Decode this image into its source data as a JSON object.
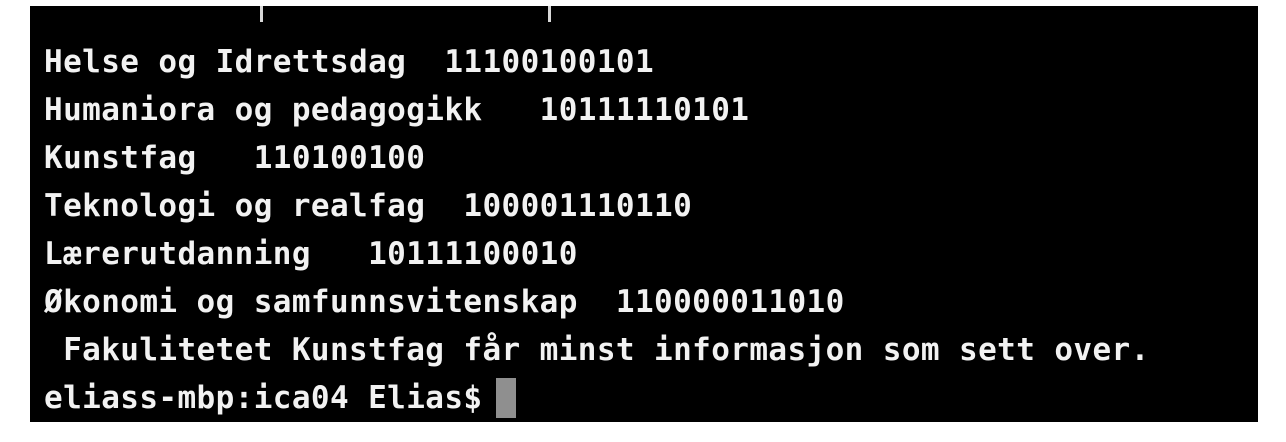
{
  "terminal": {
    "output_lines": [
      "Helse og Idrettsdag  11100100101",
      "Humaniora og pedagogikk   10111110101",
      "Kunstfag   110100100",
      "Teknologi og realfag  100001110110",
      "Lærerutdanning   10111100010",
      "Økonomi og samfunnsvitenskap  110000011010",
      " Fakulitetet Kunstfag får minst informasjon som sett over."
    ],
    "prompt": "eliass-mbp:ica04 Elias$",
    "colors": {
      "background": "#000000",
      "text": "#f2f2f2",
      "cursor": "#8f8f8f"
    }
  }
}
